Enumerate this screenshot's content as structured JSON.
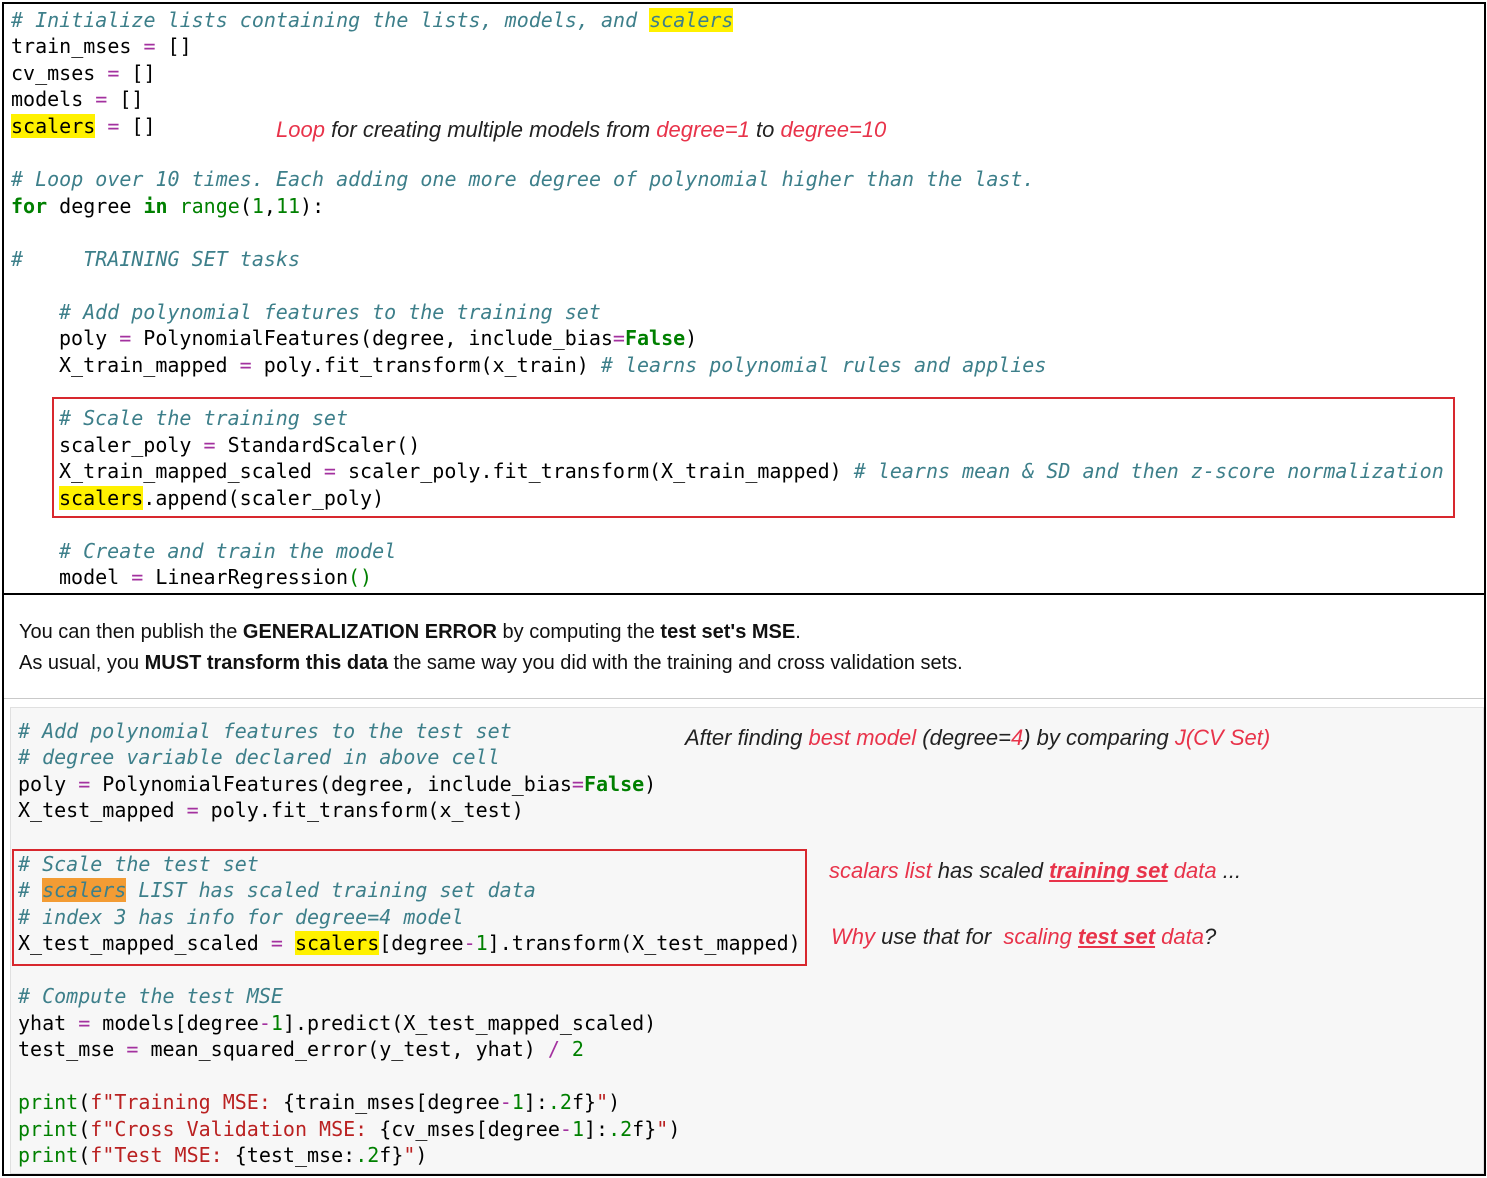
{
  "top_cell": {
    "comment_init_prefix": "# Initialize lists containing the lists, models, and ",
    "scalers_word": "scalers",
    "train_mses_var": "train_mses",
    "cv_mses_var": "cv_mses",
    "models_var": "models",
    "assign_eq": " = ",
    "empty_list": "[]",
    "comment_loop": "# Loop over 10 times. Each adding one more degree of polynomial higher than the last.",
    "for_kw": "for",
    "for_var": " degree ",
    "in_kw": "in",
    "range_fn": "range",
    "range_args_open": "(",
    "range_arg1": "1",
    "range_comma": ",",
    "range_arg2": "11",
    "range_close": "):",
    "comment_training_tasks": "#     TRAINING SET tasks",
    "comment_add_poly": "# Add polynomial features to the training set",
    "poly_line_a": "poly ",
    "poly_line_eq": "=",
    "poly_line_b": " PolynomialFeatures(degree, include_bias",
    "poly_line_eq2": "=",
    "false_kw": "False",
    "poly_line_close": ")",
    "xtrain_line_a": "X_train_mapped ",
    "xtrain_line_b": " poly.fit_transform(x_train) ",
    "xtrain_comment": "# learns polynomial rules and applies",
    "comment_scale_train": "# Scale the training set",
    "scaler_line_a": "scaler_poly ",
    "scaler_line_b": " StandardScaler()",
    "xtrain_scaled_a": "X_train_mapped_scaled ",
    "xtrain_scaled_b": " scaler_poly.fit_transform(X_train_mapped) ",
    "xtrain_scaled_comment": "# learns mean & SD and then z-score normalization",
    "append_rest": ".append(scaler_poly)",
    "comment_create_model": "# Create and train the model",
    "model_line_a": "model ",
    "model_line_b": " LinearRegression",
    "model_parens": "()"
  },
  "annotation_loop": {
    "loop_word": "Loop",
    "middle": " for creating multiple models from ",
    "deg1": "degree=1",
    "to_word": " to ",
    "deg10": "degree=10"
  },
  "markdown_cell": {
    "line1_a": "You can then publish the ",
    "line1_b": "GENERALIZATION ERROR",
    "line1_c": " by computing the ",
    "line1_d": "test set's MSE",
    "line1_e": ".",
    "line2_a": "As usual, you ",
    "line2_b": "MUST transform this data",
    "line2_c": " the same way you did with the training and cross validation sets."
  },
  "bottom_cell": {
    "comment_add_poly_test": "# Add polynomial features to the test set",
    "comment_degree_var": "# degree variable declared in above cell",
    "poly_line_a": "poly ",
    "poly_eq": "=",
    "poly_line_b": " PolynomialFeatures(degree, include_bias",
    "false_kw": "False",
    "close_paren": ")",
    "xtest_line_a": "X_test_mapped ",
    "xtest_line_b": " poly.fit_transform(x_test)",
    "comment_scale_test": "# Scale the test set",
    "hash_space": "# ",
    "scalers_word": "scalers",
    "comment_list_rest": " LIST has scaled training set data",
    "comment_index": "# index 3 has info for degree=4 model",
    "xtest_scaled_a": "X_test_mapped_scaled ",
    "xtest_scaled_b": "[degree",
    "minus": "-",
    "one": "1",
    "xtest_scaled_c": "].transform(X_test_mapped)",
    "comment_compute_mse": "# Compute the test MSE",
    "yhat_a": "yhat ",
    "yhat_b": " models[degree",
    "yhat_c": "].predict(X_test_mapped_scaled)",
    "test_mse_a": "test_mse ",
    "test_mse_b": " mean_squared_error(y_test, yhat) ",
    "slash": "/",
    "two": "2",
    "print_fn": "print",
    "paren_open": "(",
    "f_prefix": "f",
    "str_train": "\"Training MSE: ",
    "interp_train": "{train_mses[degree",
    "interp_fmt_close": "]:",
    "fmt_num": ".2",
    "fmt_f": "f}",
    "str_end": "\"",
    "str_cv": "\"Cross Validation MSE: ",
    "interp_cv": "{cv_mses[degree",
    "str_test": "\"Test MSE: ",
    "interp_test": "{test_mse:",
    "space": " "
  },
  "annotation_best": {
    "a": "After finding ",
    "b": "best model",
    "c": " (degree=",
    "d": "4",
    "e": ") by comparing ",
    "f": "J(CV Set)"
  },
  "annotation_scalars": {
    "a": "scalars list",
    "b": " has scaled ",
    "c": "training set",
    "d": " ",
    "e": "data",
    "f": " ..."
  },
  "annotation_why": {
    "a": "Why",
    "b": " use that for  ",
    "c": "scaling ",
    "d": "test set",
    "e": " data",
    "f": "?"
  }
}
